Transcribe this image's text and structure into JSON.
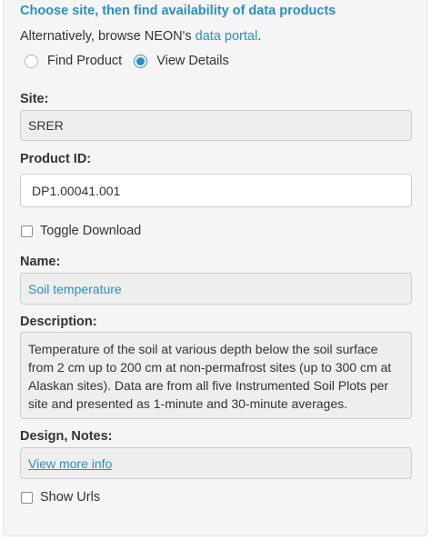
{
  "header": {
    "title": "Choose site, then find availability of data products",
    "browse_prefix": "Alternatively, browse NEON's ",
    "browse_link": "data portal",
    "browse_suffix": "."
  },
  "mode": {
    "options": [
      {
        "label": "Find Product",
        "selected": false
      },
      {
        "label": "View Details",
        "selected": true
      }
    ]
  },
  "site": {
    "label": "Site:",
    "value": "SRER"
  },
  "product": {
    "label": "Product ID:",
    "value": "DP1.00041.001"
  },
  "toggle_download": {
    "label": "Toggle Download",
    "checked": false
  },
  "name": {
    "label": "Name:",
    "value": "Soil temperature"
  },
  "description": {
    "label": "Description:",
    "value": "Temperature of the soil at various depth below the soil surface from 2 cm up to 200 cm at non-permafrost sites (up to 300 cm at Alaskan sites). Data are from all five Instrumented Soil Plots per site and presented as 1-minute and 30-minute averages."
  },
  "design": {
    "label": "Design, Notes:",
    "link": "View more info"
  },
  "show_urls": {
    "label": "Show Urls",
    "checked": false
  },
  "colors": {
    "accent": "#2a8fc1",
    "panel": "#f5f5f5",
    "readonly": "#eeeeee"
  }
}
